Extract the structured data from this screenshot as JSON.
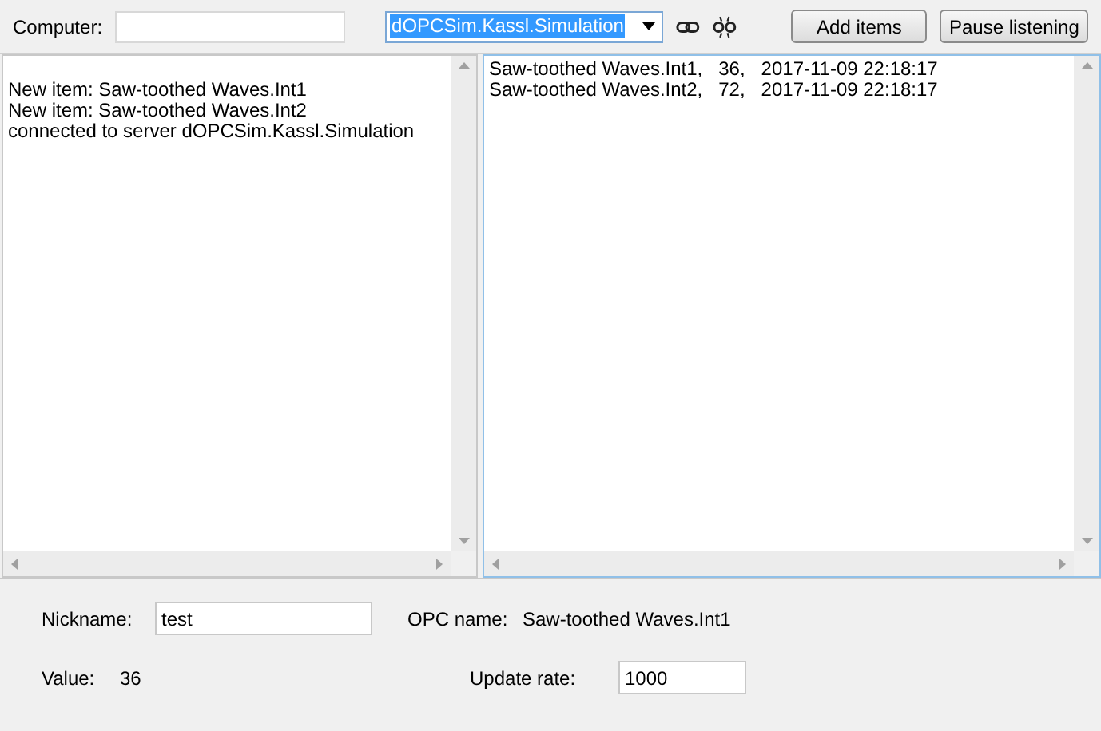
{
  "toolbar": {
    "computer_label": "Computer:",
    "server": "dOPCSim.Kassl.Simulation",
    "buttons": [
      "Add items",
      "Pause listening"
    ]
  },
  "log": [
    "New item: Saw-toothed Waves.Int1",
    "New item: Saw-toothed Waves.Int2",
    "connected to server dOPCSim.Kassl.Simulation"
  ],
  "values": [
    "Saw-toothed Waves.Int1,   36,   2017-11-09 22:18:17",
    "Saw-toothed Waves.Int2,   72,   2017-11-09 22:18:17"
  ],
  "details": {
    "nickname_label": "Nickname:",
    "nickname": "test",
    "opc_name_label": "OPC name:",
    "opc_name": "Saw-toothed Waves.Int1",
    "value_label": "Value:",
    "value": "36",
    "update_rate_label": "Update rate:",
    "update_rate": "1000"
  }
}
